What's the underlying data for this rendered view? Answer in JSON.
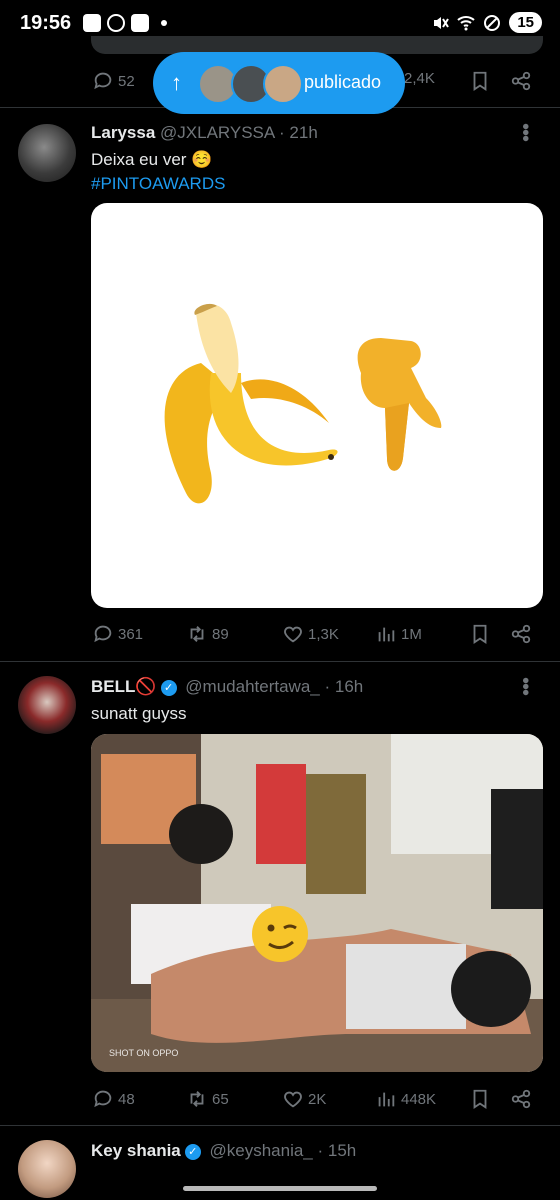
{
  "status_bar": {
    "time": "19:56",
    "battery": "15",
    "icons": [
      "youtube-icon",
      "whatsapp-icon",
      "shopping-icon",
      "dot-icon",
      "mute-icon",
      "wifi-icon",
      "dnd-icon"
    ]
  },
  "top_tweet": {
    "replies": "52",
    "views": "2,4K"
  },
  "posted_pill": {
    "label": "publicado"
  },
  "tweets": [
    {
      "name": "Laryssa",
      "handle": "@JXLARYSSA",
      "time": "· 21h",
      "text": "Deixa eu ver ☺️",
      "hashtag": "#PINTOAWARDS",
      "replies": "361",
      "retweets": "89",
      "likes": "1,3K",
      "views": "1M"
    },
    {
      "name": "BELL🚫",
      "handle": "@mudahtertawa_",
      "time": "· 16h",
      "text": "sunatt guyss",
      "watermark": "SHOT ON OPPO",
      "replies": "48",
      "retweets": "65",
      "likes": "2K",
      "views": "448K"
    },
    {
      "name": "Key shania",
      "handle": "@keyshania_",
      "time": "· 15h"
    }
  ],
  "colors": {
    "accent": "#1d9bf0",
    "muted": "#71767b",
    "text": "#e7e9ea",
    "background": "#000000"
  }
}
